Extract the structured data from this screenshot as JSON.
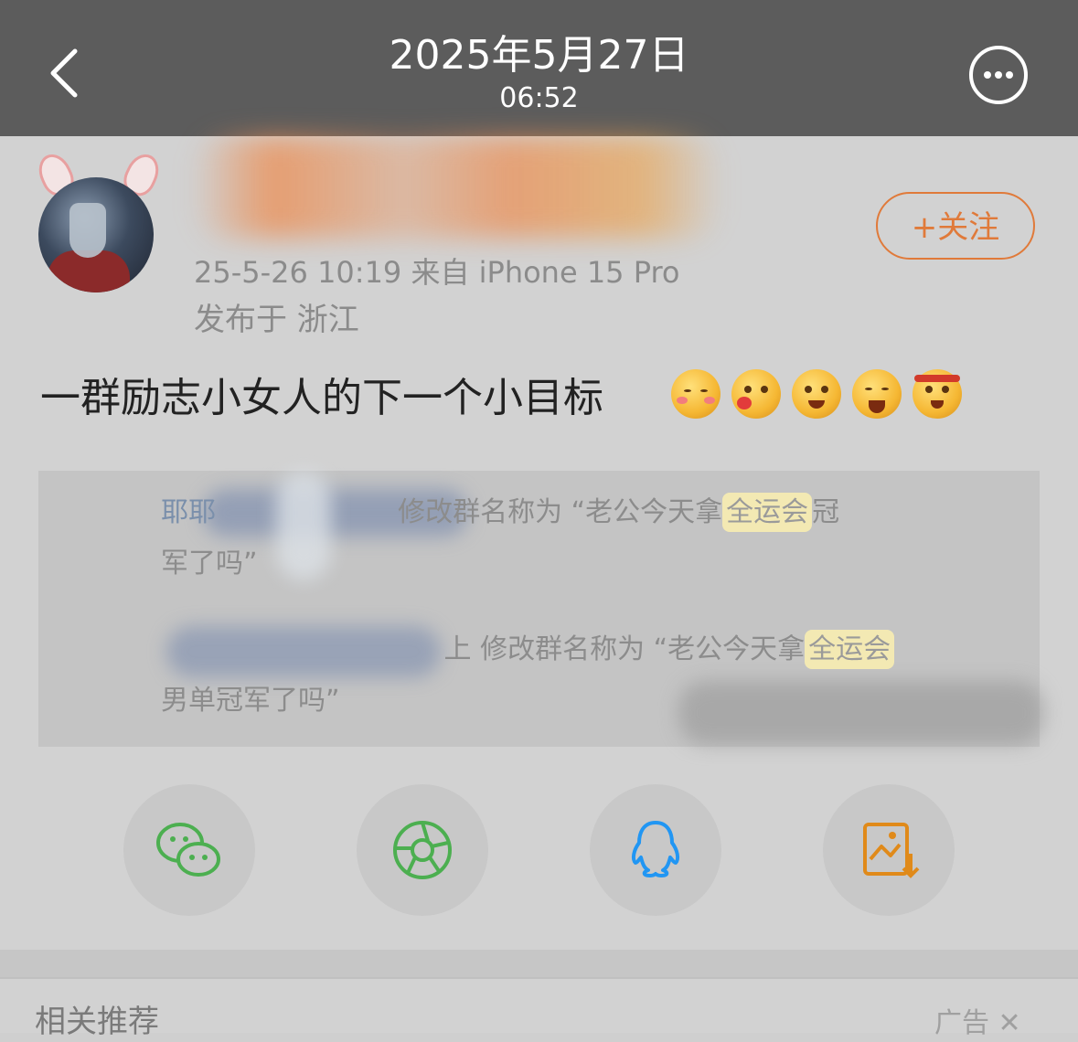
{
  "header": {
    "date": "2025年5月27日",
    "time": "06:52"
  },
  "post": {
    "meta": "25-5-26 10:19  来自 iPhone 15 Pro",
    "location": "发布于 浙江",
    "follow_label": "+关注",
    "text": "一群励志小女人的下一个小目标"
  },
  "screenshot": {
    "line1_prefix": "耶耶",
    "line1_mid": "修改群名称为 “老公今天拿",
    "line1_hl": "全运会",
    "line1_end": "冠",
    "line2": "军了吗”",
    "line3_prefix": "上",
    "line3_mid": "修改群名称为 “老公今天拿",
    "line3_hl": "全运会",
    "line4": "男单冠军了吗”"
  },
  "share_targets": [
    "wechat-icon",
    "moments-icon",
    "qq-icon",
    "save-image-icon"
  ],
  "recommend": {
    "title": "相关推荐",
    "ad_label": "广告 ✕"
  },
  "colors": {
    "accent": "#e07a3a",
    "wechat": "#4caf50",
    "qq": "#2196f3",
    "save": "#e08a1a"
  }
}
